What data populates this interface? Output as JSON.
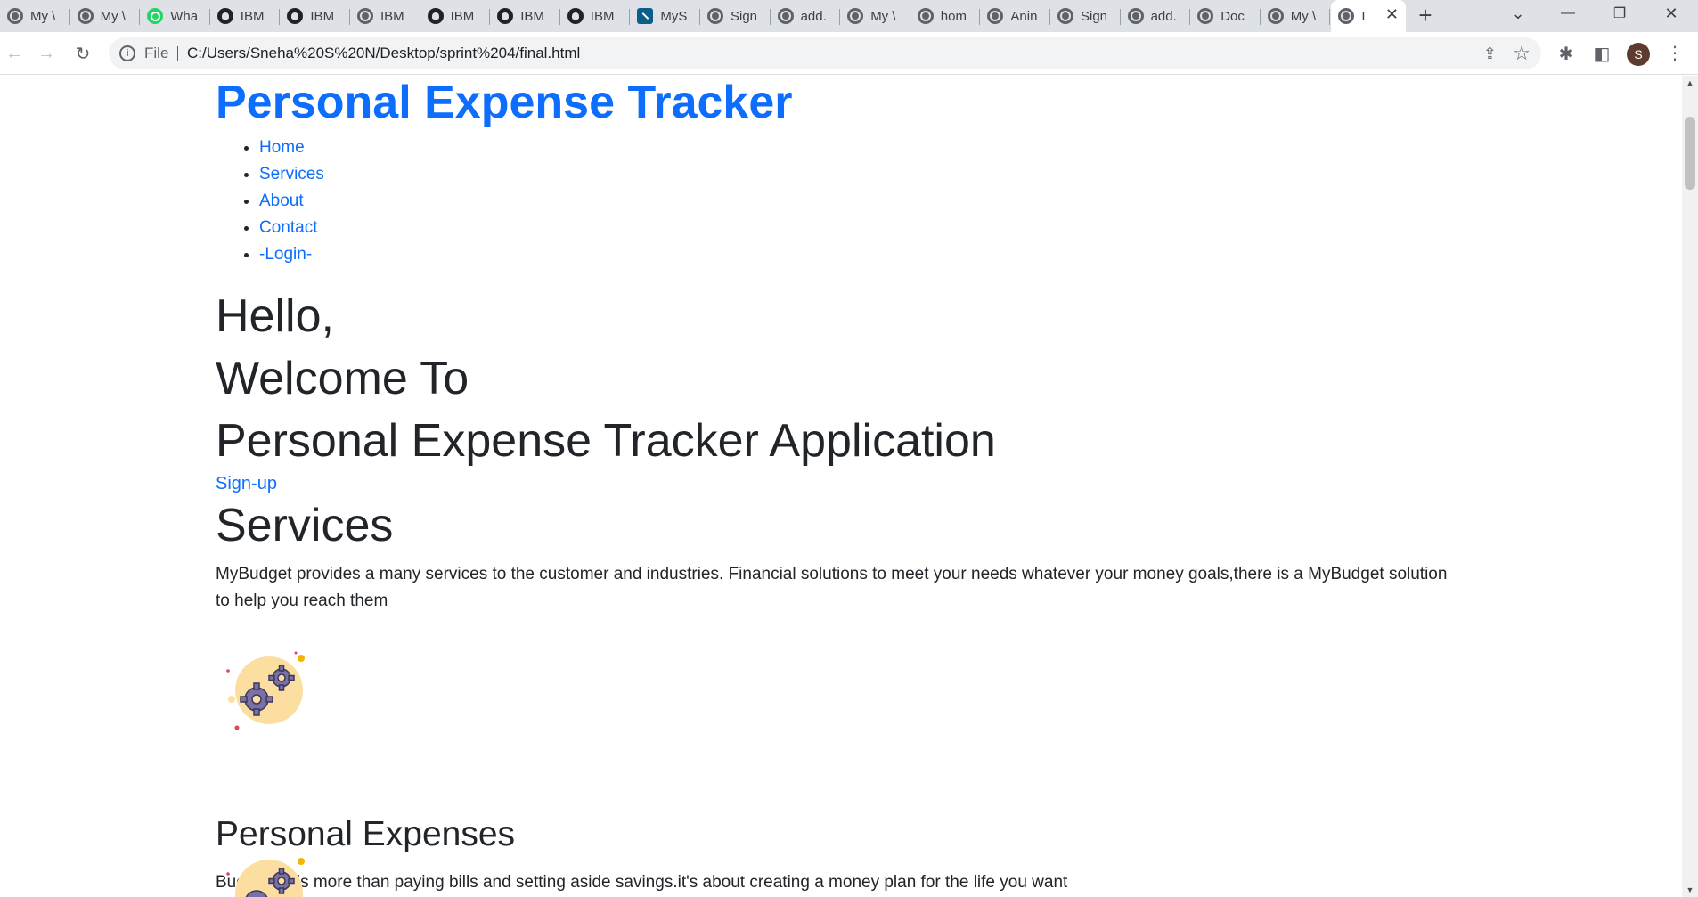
{
  "browser": {
    "tabs": [
      {
        "label": "My \\",
        "icon": "globe"
      },
      {
        "label": "My \\",
        "icon": "globe"
      },
      {
        "label": "Wha",
        "icon": "whatsapp"
      },
      {
        "label": "IBM",
        "icon": "github"
      },
      {
        "label": "IBM",
        "icon": "github"
      },
      {
        "label": "IBM",
        "icon": "globe"
      },
      {
        "label": "IBM",
        "icon": "github"
      },
      {
        "label": "IBM",
        "icon": "github"
      },
      {
        "label": "IBM",
        "icon": "github"
      },
      {
        "label": "MyS",
        "icon": "mysql"
      },
      {
        "label": "Sign",
        "icon": "globe"
      },
      {
        "label": "add.",
        "icon": "globe"
      },
      {
        "label": "My \\",
        "icon": "globe"
      },
      {
        "label": "hom",
        "icon": "globe"
      },
      {
        "label": "Anin",
        "icon": "globe"
      },
      {
        "label": "Sign",
        "icon": "globe"
      },
      {
        "label": "add.",
        "icon": "globe"
      },
      {
        "label": "Doc",
        "icon": "globe"
      },
      {
        "label": "My \\",
        "icon": "globe"
      },
      {
        "label": "I",
        "icon": "globe",
        "active": true
      }
    ],
    "new_tab": "+",
    "tab_search": "⌄",
    "minimize": "—",
    "maximize": "❐",
    "close": "✕",
    "back": "←",
    "forward": "→",
    "reload": "↻",
    "scheme": "File",
    "url": "C:/Users/Sneha%20S%20N/Desktop/sprint%204/final.html",
    "share": "⇪",
    "bookmark": "☆",
    "extensions": "✱",
    "side_panel": "◧",
    "profile_initial": "S",
    "menu": "⋮"
  },
  "page": {
    "site_title": "Personal Expense Tracker",
    "nav": [
      "Home",
      "Services",
      "About",
      "Contact",
      "-Login-"
    ],
    "hero_lines": [
      "Hello,",
      "Welcome To",
      "Personal Expense Tracker Application"
    ],
    "signup_link": "Sign-up",
    "services_title": "Services",
    "services_text": "MyBudget provides a many services to the customer and industries. Financial solutions to meet your needs whatever your money goals,there is a MyBudget solution to help you reach them",
    "cards": [
      {
        "title": "Personal Expenses",
        "text": "Budgeting is more than paying bills and setting aside savings.it's about creating a money plan for the life you want",
        "icon": "gears-icon"
      },
      {
        "title": "",
        "text": "",
        "icon": "gears-icon"
      }
    ]
  },
  "colors": {
    "link": "#0d6efd",
    "text": "#212529",
    "tabbar": "#dee1e6",
    "icon_circle": "#fcdfa0",
    "gear": "#7a72a6"
  }
}
